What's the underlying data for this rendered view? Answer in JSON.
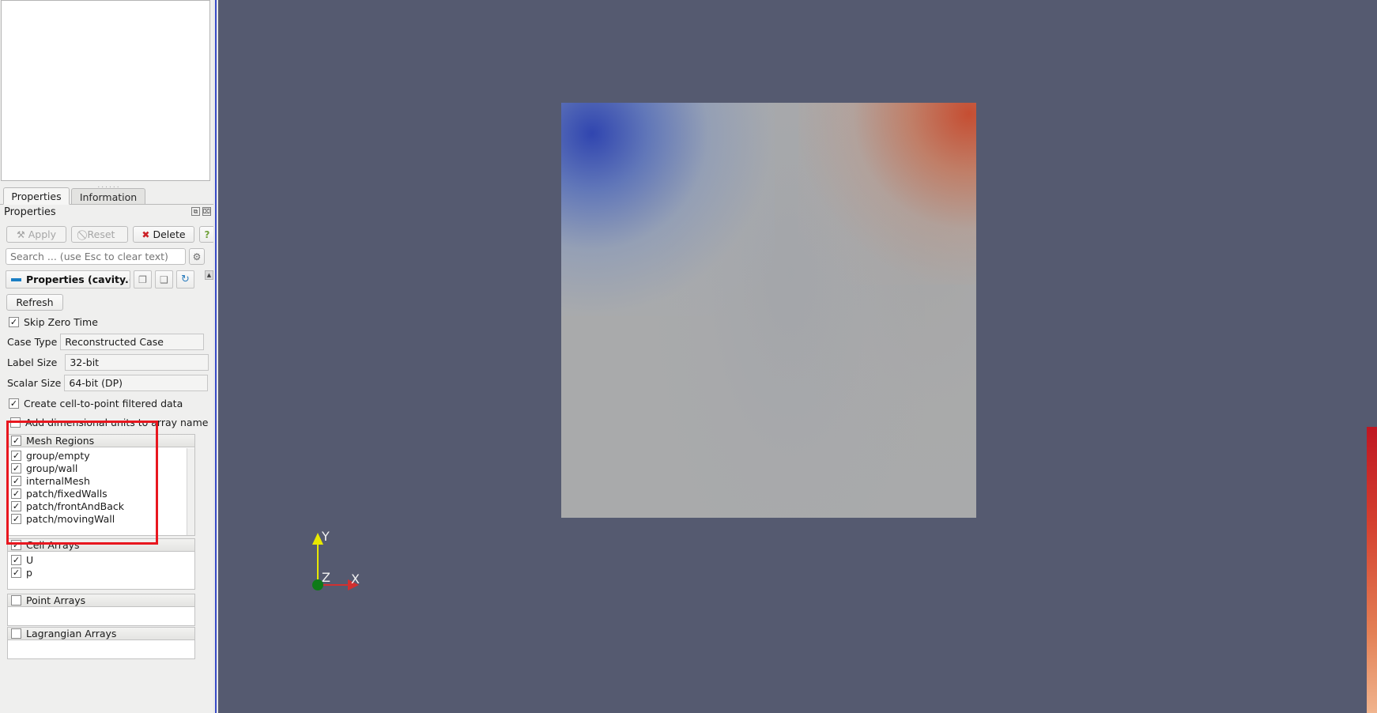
{
  "panel": {
    "tabs": [
      {
        "label": "Properties",
        "active": true
      },
      {
        "label": "Information",
        "active": false
      }
    ],
    "section_title": "Properties",
    "corner_buttons": [
      {
        "name": "undock-panel-button",
        "glyph": "⧉"
      },
      {
        "name": "close-panel-button",
        "glyph": "⌧"
      }
    ],
    "toolbar": {
      "apply_label": "Apply",
      "apply_glyph": "⚒",
      "reset_label": "Reset",
      "reset_glyph": "⃠",
      "delete_label": "Delete",
      "delete_glyph": "✖",
      "help_glyph": "?"
    },
    "search": {
      "placeholder": "Search ... (use Esc to clear text)",
      "value": "",
      "gear_glyph": "⚙"
    },
    "properties_header": {
      "title": "Properties (cavity.(",
      "copy_glyph": "❐",
      "paste_glyph": "❑",
      "reload_glyph": "↻",
      "scroll_up_glyph": "▲"
    },
    "refresh_label": "Refresh",
    "skip_zero_time": {
      "label": "Skip Zero Time",
      "checked": true
    },
    "case_type": {
      "label": "Case Type",
      "value": "Reconstructed Case"
    },
    "label_size": {
      "label": "Label Size",
      "value": "32-bit"
    },
    "scalar_size": {
      "label": "Scalar Size",
      "value": "64-bit (DP)"
    },
    "cell_to_point": {
      "label": "Create cell-to-point filtered data",
      "checked": true
    },
    "add_dimensional_units": {
      "label": "Add dimensional units to array name",
      "checked": false
    },
    "mesh_regions": {
      "header": "Mesh Regions",
      "header_checked": true,
      "items": [
        {
          "label": "group/empty",
          "checked": true
        },
        {
          "label": "group/wall",
          "checked": true
        },
        {
          "label": "internalMesh",
          "checked": true
        },
        {
          "label": "patch/fixedWalls",
          "checked": true
        },
        {
          "label": "patch/frontAndBack",
          "checked": true
        },
        {
          "label": "patch/movingWall",
          "checked": true
        }
      ]
    },
    "cell_arrays": {
      "header": "Cell Arrays",
      "header_checked": true,
      "items": [
        {
          "label": "U",
          "checked": true
        },
        {
          "label": "p",
          "checked": true
        }
      ]
    },
    "point_arrays": {
      "header": "Point Arrays",
      "header_checked": false,
      "items": []
    },
    "lagrangian_arrays": {
      "header": "Lagrangian Arrays",
      "header_checked": false,
      "items": []
    }
  },
  "render_view": {
    "background_color": "#555a70",
    "mesh_base_color": "#a9aaab",
    "hot_color": "#c8462a",
    "cold_color": "#2a40b0",
    "axes": {
      "x_label": "X",
      "y_label": "Y",
      "z_label": "Z",
      "x_color": "#d03030",
      "y_color": "#e8e800",
      "z_color": "#0e7a18"
    }
  },
  "annotation": {
    "highlight_color": "#e8171f",
    "target": "mesh-regions"
  },
  "checkbox_glyph": "✓"
}
